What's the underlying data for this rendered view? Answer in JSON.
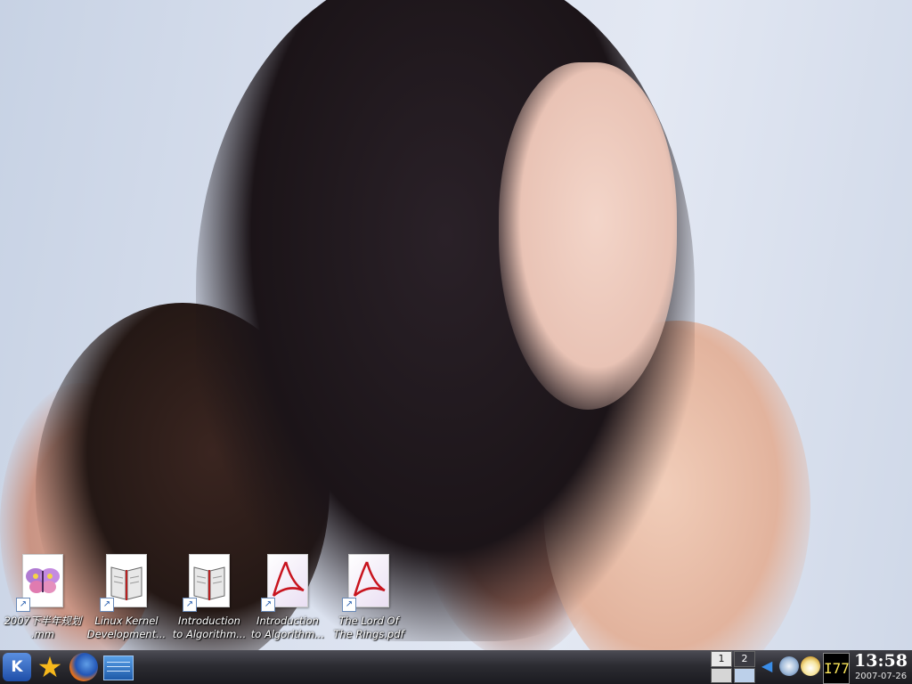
{
  "desktop": {
    "icons": [
      {
        "line1": "2007下半年规划",
        "line2": ".mm",
        "icon": "butterfly-icon"
      },
      {
        "line1": "Linux Kernel",
        "line2": "Development...",
        "icon": "book-icon"
      },
      {
        "line1": "Introduction",
        "line2": "to Algorithm...",
        "icon": "book-icon"
      },
      {
        "line1": "Introduction",
        "line2": "to Algorithm...",
        "icon": "pdf-icon"
      },
      {
        "line1": "The Lord Of",
        "line2": "The Rings.pdf",
        "icon": "pdf-icon"
      }
    ]
  },
  "taskbar": {
    "kmenu_label": "K",
    "pager": [
      {
        "label": "1"
      },
      {
        "label": "2"
      }
    ],
    "cpu_label": "I77",
    "clock": {
      "time": "13:58",
      "date": "2007-07-26"
    }
  }
}
